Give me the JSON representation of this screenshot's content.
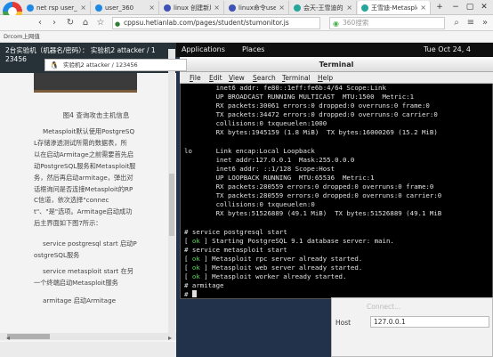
{
  "browser": {
    "tabs": [
      {
        "label": "net rsp user_360",
        "fav_color": "#1e88e5"
      },
      {
        "label": "user_360",
        "fav_color": "#1e88e5"
      },
      {
        "label": "linux 创建新用户",
        "fav_color": "#3f51b5"
      },
      {
        "label": "linux命令user&&",
        "fav_color": "#3f51b5"
      },
      {
        "label": "会天-王雪迪的实验",
        "fav_color": "#26a69a"
      },
      {
        "label": "王雪迪-Metasploi",
        "fav_color": "#26a69a"
      }
    ],
    "url": "cppsu.hetianlab.com/pages/student/stumonitor.js",
    "search_placeholder": "360搜索",
    "bookmark": "Drcom上网值"
  },
  "left": {
    "header_line1": "2台实验机（机器名/密码）： 实验机2 attacker / 1",
    "header_line2": "23456",
    "caption": "图4 查询攻击主机信息",
    "para1": [
      "Metasploit默认使用PostgreSQ",
      "L存储渗透测试所需的数据表，所",
      "以在启动Armitage之前需要首先启",
      "动PostgreSQL服务和Metasploit服",
      "务，然后再启动armitage，弹出对",
      "话框询问是否连接Metasploit的RP",
      "C信道，依次选择\"connec",
      "t\"、\"是\"选项。Armitage启动成功",
      "后主界面如下图7所示："
    ],
    "para2": [
      "service postgresql start 启动P",
      "ostgreSQL服务"
    ],
    "para3": [
      "service metasploit start 在另",
      "一个终端启动Metasploit服务"
    ],
    "para4": "armitage 启动Armitage"
  },
  "remote": {
    "applications": "Applications",
    "places": "Places",
    "clock": "Tue Oct 24, 4",
    "session_label": "实验机2    attacker / 123456"
  },
  "terminal": {
    "title": "Terminal",
    "menu": [
      "File",
      "Edit",
      "View",
      "Search",
      "Terminal",
      "Help"
    ],
    "lines": [
      "        inet6 addr: fe80::1eff:fe6b:4/64 Scope:Link",
      "        UP BROADCAST RUNNING MULTICAST  MTU:1500  Metric:1",
      "        RX packets:30061 errors:0 dropped:0 overruns:0 frame:0",
      "        TX packets:34472 errors:0 dropped:0 overruns:0 carrier:0",
      "        collisions:0 txqueuelen:1000",
      "        RX bytes:1945159 (1.8 MiB)  TX bytes:16000269 (15.2 MiB)",
      "",
      "lo      Link encap:Local Loopback",
      "        inet addr:127.0.0.1  Mask:255.0.0.0",
      "        inet6 addr: ::1/128 Scope:Host",
      "        UP LOOPBACK RUNNING  MTU:65536  Metric:1",
      "        RX packets:280559 errors:0 dropped:0 overruns:0 frame:0",
      "        TX packets:280559 errors:0 dropped:0 overruns:0 carrier:0",
      "        collisions:0 txqueuelen:0",
      "        RX bytes:51526889 (49.1 MiB)  TX bytes:51526889 (49.1 MiB",
      "",
      "# service postgresql start",
      "[ ok ] Starting PostgreSQL 9.1 database server: main.",
      "# service metasploit start",
      "[ ok ] Metasploit rpc server already started.",
      "[ ok ] Metasploit web server already started.",
      "[ ok ] Metasploit worker already started.",
      "# armitage",
      "#"
    ]
  },
  "connect": {
    "title": "Connect...",
    "host_label": "Host",
    "host_value": "127.0.0.1"
  }
}
